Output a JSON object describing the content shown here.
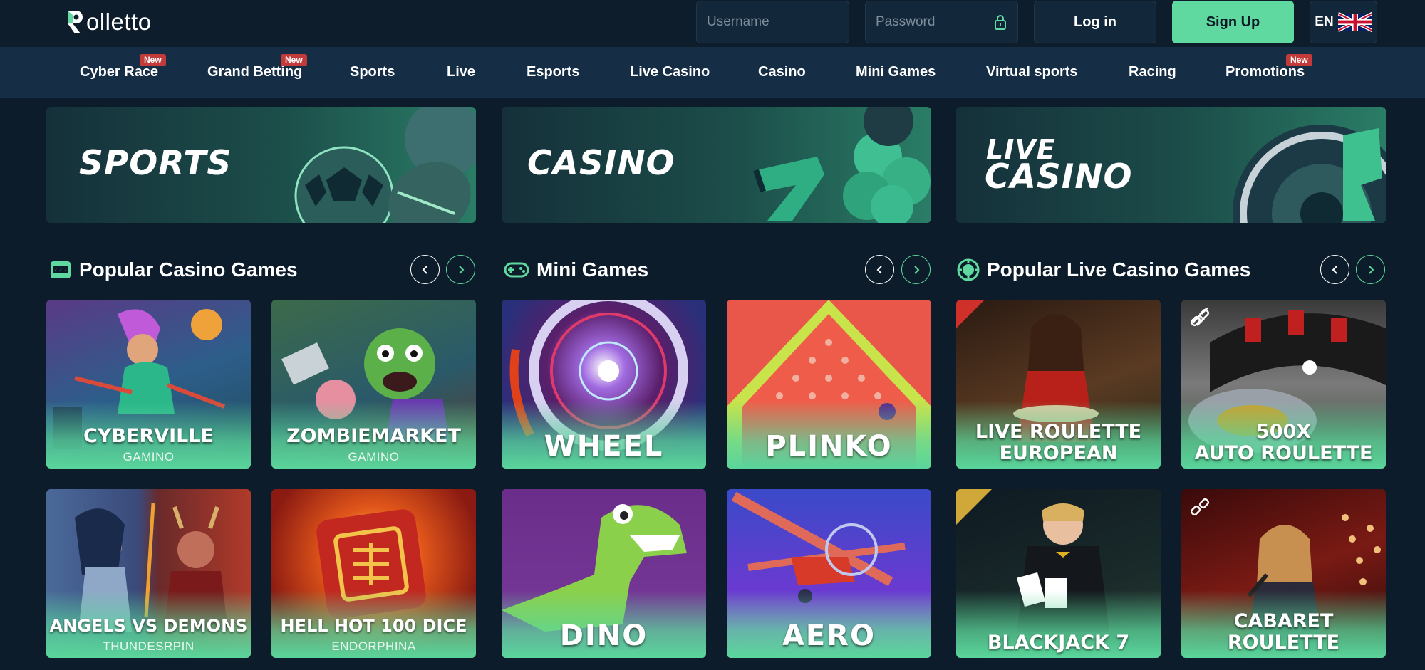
{
  "header": {
    "logo_text": "olletto",
    "logo_initial": "R",
    "username_placeholder": "Username",
    "password_placeholder": "Password",
    "login_label": "Log in",
    "signup_label": "Sign Up",
    "language": "EN"
  },
  "nav": {
    "items": [
      {
        "label": "Cyber Race",
        "badge": "New"
      },
      {
        "label": "Grand Betting",
        "badge": "New"
      },
      {
        "label": "Sports"
      },
      {
        "label": "Live"
      },
      {
        "label": "Esports"
      },
      {
        "label": "Live Casino"
      },
      {
        "label": "Casino"
      },
      {
        "label": "Mini Games"
      },
      {
        "label": "Virtual sports"
      },
      {
        "label": "Racing"
      },
      {
        "label": "Promotions",
        "badge": "New"
      }
    ]
  },
  "banners": [
    {
      "title": "SPORTS"
    },
    {
      "title": "CASINO"
    },
    {
      "title_line1": "LIVE",
      "title_line2": "CASINO"
    }
  ],
  "sections": [
    {
      "title": "Popular Casino Games",
      "icon": "slot-machine-icon"
    },
    {
      "title": "Mini Games",
      "icon": "gamepad-icon"
    },
    {
      "title": "Popular Live Casino Games",
      "icon": "poker-chip-icon"
    }
  ],
  "casino_games": [
    {
      "name": "CYBERVILLE",
      "provider": "GAMINO"
    },
    {
      "name": "ZOMBIEMARKET",
      "provider": "GAMINO"
    },
    {
      "name": "ANGELS VS DEMONS",
      "provider": "THUNDESRPIN"
    },
    {
      "name": "HELL HOT 100 DICE",
      "provider": "ENDORPHINA"
    }
  ],
  "mini_games": [
    {
      "name": "WHEEL"
    },
    {
      "name": "PLINKO"
    },
    {
      "name": "DINO"
    },
    {
      "name": "AERO"
    }
  ],
  "live_games": [
    {
      "name_line1": "LIVE ROULETTE",
      "name_line2": "EUROPEAN"
    },
    {
      "name_line1": "500X",
      "name_line2": "AUTO ROULETTE"
    },
    {
      "name_line1": "BLACKJACK 7"
    },
    {
      "name_line1": "CABARET",
      "name_line2": "ROULETTE"
    }
  ],
  "colors": {
    "background": "#0d1c2a",
    "nav_background": "#152d45",
    "accent_green": "#5fd9a0",
    "badge_red": "#c33a3a"
  }
}
